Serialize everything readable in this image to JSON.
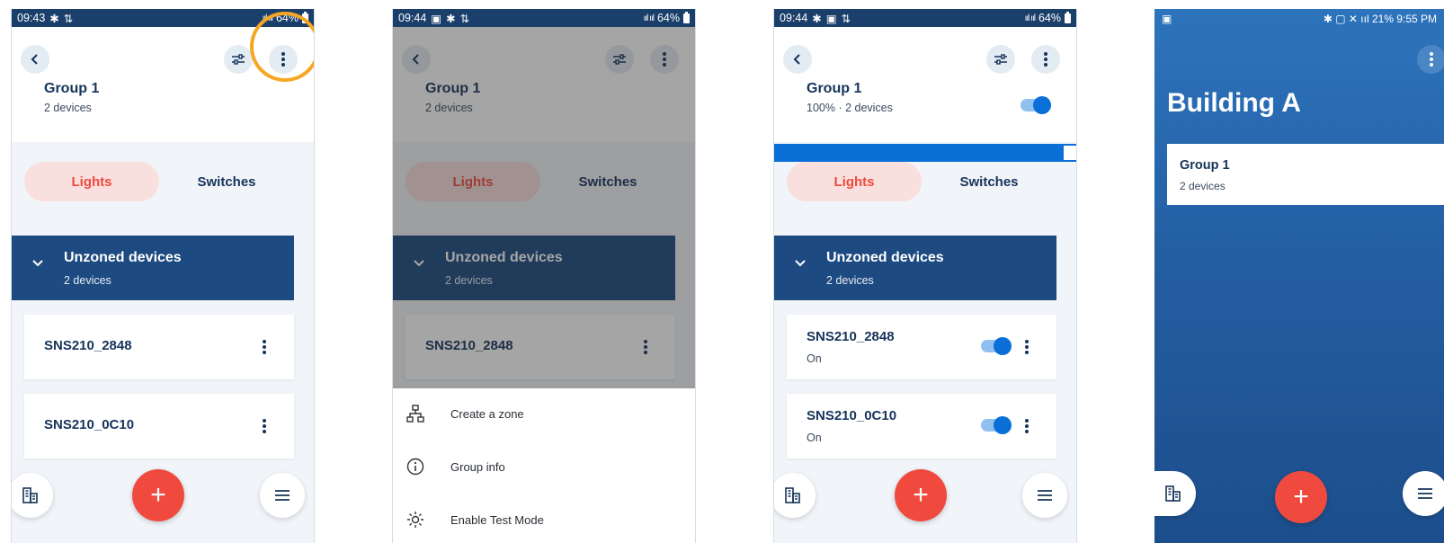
{
  "colors": {
    "primary_navy": "#1d4a80",
    "accent_red": "#f04a3f",
    "toggle_blue": "#0a6fd6",
    "highlight_ring": "#f5a623"
  },
  "screen1": {
    "status": {
      "time": "09:43",
      "signal": "64%"
    },
    "group": {
      "title": "Group 1",
      "subtitle": "2 devices"
    },
    "tabs": {
      "lights": "Lights",
      "switches": "Switches"
    },
    "zone": {
      "title": "Unzoned devices",
      "subtitle": "2 devices"
    },
    "devices": [
      {
        "name": "SNS210_2848"
      },
      {
        "name": "SNS210_0C10"
      }
    ],
    "fab": "+"
  },
  "screen2": {
    "status": {
      "time": "09:44",
      "signal": "64%"
    },
    "group": {
      "title": "Group 1",
      "subtitle": "2 devices"
    },
    "tabs": {
      "lights": "Lights",
      "switches": "Switches"
    },
    "zone": {
      "title": "Unzoned devices",
      "subtitle": "2 devices"
    },
    "devices": [
      {
        "name": "SNS210_2848"
      }
    ],
    "menu": [
      {
        "label": "Create a zone",
        "icon": "network-icon"
      },
      {
        "label": "Group info",
        "icon": "info-icon"
      },
      {
        "label": "Enable Test Mode",
        "icon": "sun-icon"
      }
    ]
  },
  "screen3": {
    "status": {
      "time": "09:44",
      "signal": "64%"
    },
    "group": {
      "title": "Group 1",
      "subtitle": "100% · 2 devices",
      "on": true
    },
    "tabs": {
      "lights": "Lights",
      "switches": "Switches"
    },
    "zone": {
      "title": "Unzoned devices",
      "subtitle": "2 devices"
    },
    "devices": [
      {
        "name": "SNS210_2848",
        "state": "On"
      },
      {
        "name": "SNS210_0C10",
        "state": "On"
      }
    ],
    "fab": "+"
  },
  "screen4": {
    "status": {
      "right": "21% 9:55 PM"
    },
    "title": "Building A",
    "group": {
      "title": "Group 1",
      "subtitle": "2 devices"
    },
    "fab": "+"
  }
}
